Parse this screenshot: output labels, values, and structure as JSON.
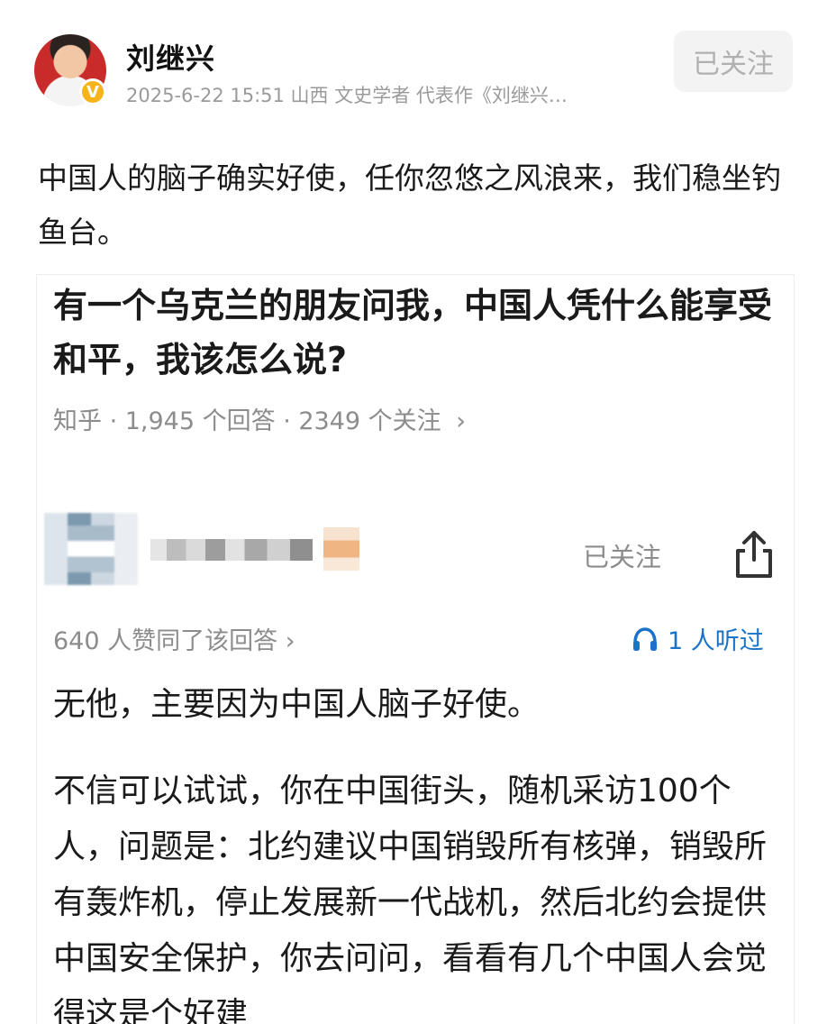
{
  "post": {
    "author_name": "刘继兴",
    "verified_badge": "V",
    "meta": "2025-6-22 15:51 山西 文史学者 代表作《刘继兴…",
    "follow_label": "已关注",
    "body": "中国人的脑子确实好使，任你忽悠之风浪来，我们稳坐钓鱼台。"
  },
  "card": {
    "question_title": "有一个乌克兰的朋友问我，中国人凭什么能享受和平，我该怎么说?",
    "question_meta": "知乎 · 1,945 个回答 · 2349 个关注",
    "question_meta_chevron": "›",
    "follow_label": "已关注",
    "likes_text": "640 人赞同了该回答",
    "likes_chevron": "›",
    "listened_text": "1 人听过",
    "answer_p1": "无他，主要因为中国人脑子好使。",
    "answer_p2": "不信可以试试，你在中国街头，随机采访100个人，问题是：北约建议中国销毁所有核弹，销毁所有轰炸机，停止发展新一代战机，然后北约会提供中国安全保护，你去问问，看看有几个中国人会觉得这是个好建"
  },
  "icons": {
    "share": "share-icon",
    "headphone": "headphone-icon"
  },
  "colors": {
    "badge": "#f6b41a",
    "link_blue": "#1a73c8",
    "muted_text": "#8c8c8c"
  }
}
